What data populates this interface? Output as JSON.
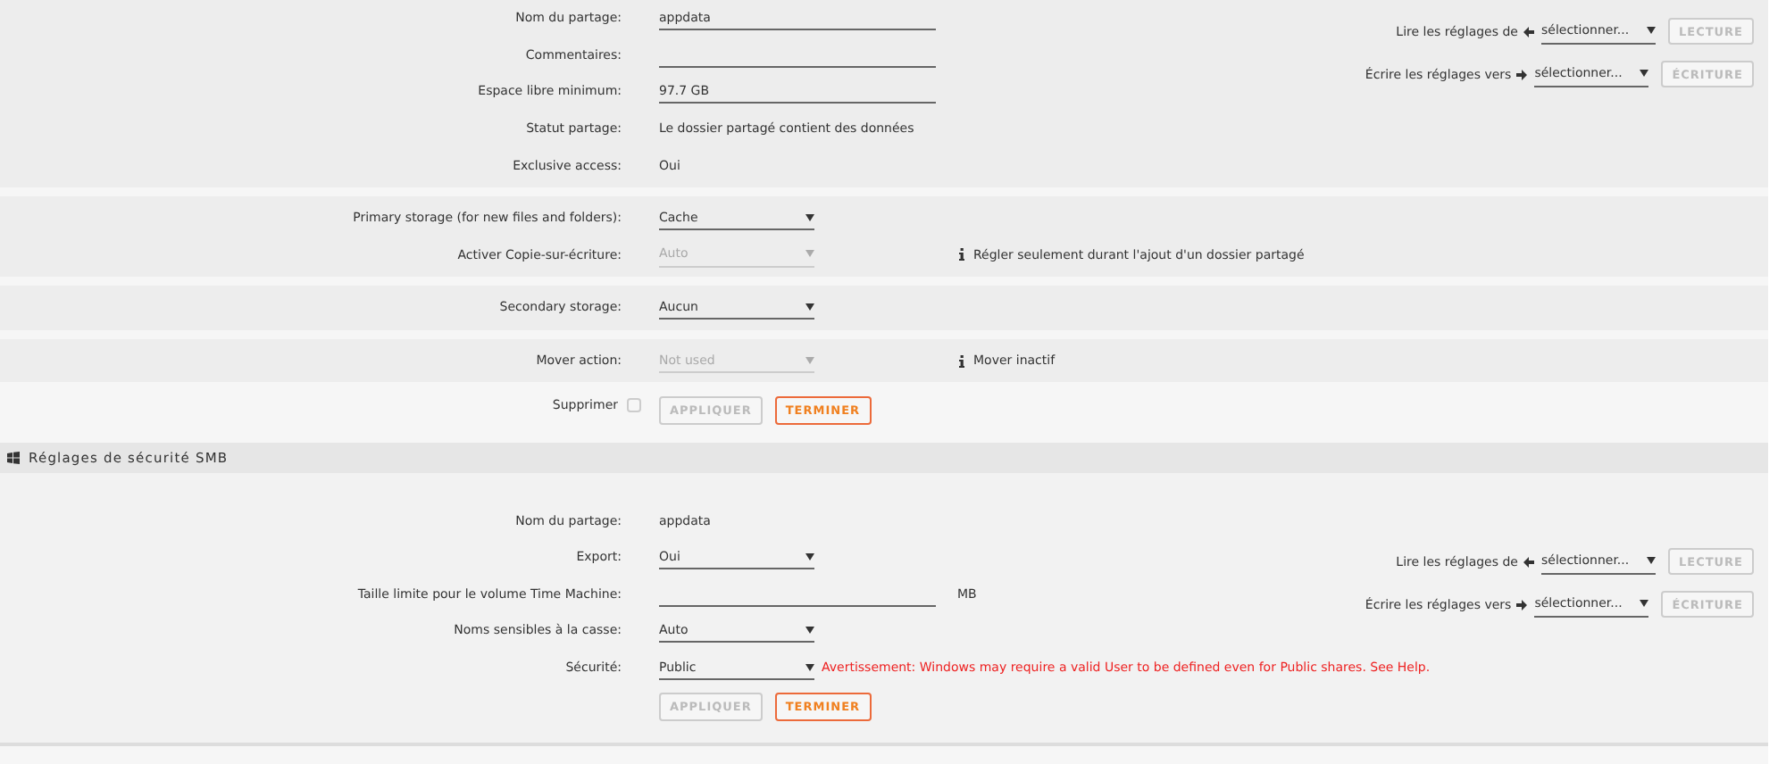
{
  "share": {
    "rows": [
      {
        "label": "Nom du partage:",
        "kind": "input",
        "value": "appdata"
      },
      {
        "label": "Commentaires:",
        "kind": "input"
      },
      {
        "label": "Espace libre minimum:",
        "kind": "input",
        "value": "97.7 GB"
      },
      {
        "label": "Statut partage:",
        "kind": "text",
        "value": "Le dossier partagé contient des données"
      },
      {
        "label": "Exclusive access:",
        "kind": "text",
        "value": "Oui"
      }
    ],
    "copy": [
      {
        "label": "Lire les réglages de",
        "kind": "read",
        "value": "sélectionner...",
        "button": "LECTURE",
        "disabled": true
      },
      {
        "label": "Écrire les réglages vers",
        "kind": "write",
        "value": "sélectionner...",
        "button": "ÉCRITURE",
        "disabled": true
      }
    ],
    "groups": [
      {
        "rows": [
          {
            "label": "Primary storage (for new files and folders):",
            "kind": "select",
            "value": "Cache",
            "disabled": false
          },
          {
            "label": "Activer Copie-sur-écriture:",
            "kind": "select",
            "value": "Auto",
            "disabled": true,
            "note": "Régler seulement durant l'ajout d'un dossier partagé"
          }
        ]
      },
      {
        "rows": [
          {
            "label": "Secondary storage:",
            "kind": "select",
            "value": "Aucun",
            "disabled": false
          }
        ]
      },
      {
        "rows": [
          {
            "label": "Mover action:",
            "kind": "select",
            "value": "Not used",
            "disabled": true,
            "note": "Mover inactif"
          }
        ]
      }
    ],
    "delete": {
      "label": "Supprimer",
      "checked": false
    },
    "buttons": [
      {
        "label": "APPLIQUER",
        "disabled": true
      },
      {
        "label": "TERMINER",
        "disabled": false
      }
    ]
  },
  "smb": {
    "title": "Réglages de sécurité SMB",
    "rows": [
      {
        "label": "Nom du partage:",
        "kind": "text",
        "value": "appdata"
      },
      {
        "label": "Export:",
        "kind": "select",
        "value": "Oui",
        "disabled": false
      },
      {
        "label": "Taille limite pour le volume Time Machine:",
        "kind": "input",
        "unit": "MB"
      },
      {
        "label": "Noms sensibles à la casse:",
        "kind": "select",
        "value": "Auto",
        "disabled": false
      },
      {
        "label": "Sécurité:",
        "kind": "select",
        "value": "Public",
        "disabled": false,
        "warning": "Avertissement: Windows may require a valid User to be defined even for Public shares. See Help."
      }
    ],
    "copy": [
      {
        "label": "Lire les réglages de",
        "kind": "read",
        "value": "sélectionner...",
        "button": "LECTURE",
        "disabled": true
      },
      {
        "label": "Écrire les réglages vers",
        "kind": "write",
        "value": "sélectionner...",
        "button": "ÉCRITURE",
        "disabled": true
      }
    ],
    "buttons": [
      {
        "label": "APPLIQUER",
        "disabled": true
      },
      {
        "label": "TERMINER",
        "disabled": false
      }
    ]
  }
}
